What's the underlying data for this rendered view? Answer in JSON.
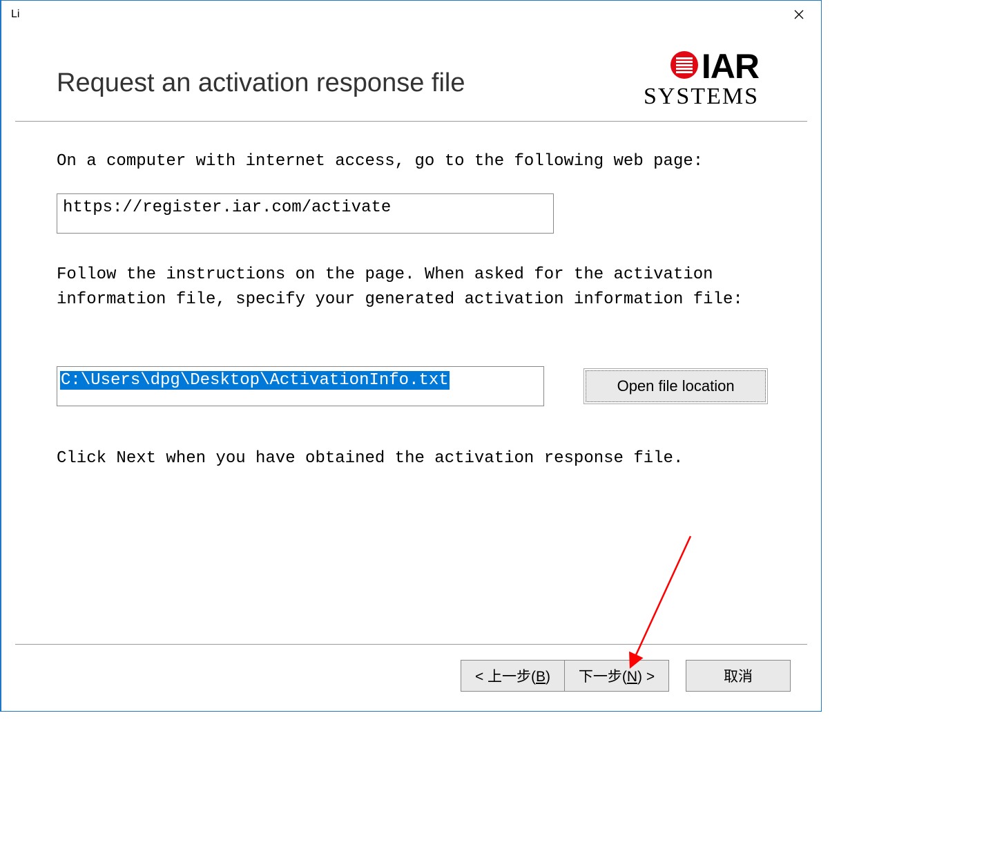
{
  "window": {
    "title": "Li"
  },
  "header": {
    "page_title": "Request an activation response file",
    "logo_top": "IAR",
    "logo_bottom": "SYSTEMS"
  },
  "body": {
    "instruction_1": "On a computer with internet access, go to the following web page:",
    "url_value": "https://register.iar.com/activate",
    "instruction_2": "Follow the instructions on the page. When asked for the activation information file, specify your generated activation information file:",
    "file_path_value": "C:\\Users\\dpg\\Desktop\\ActivationInfo.txt",
    "open_location_label": "Open file location",
    "instruction_3": "Click Next when you have obtained the activation response file."
  },
  "footer": {
    "back_prefix": "< 上一步(",
    "back_key": "B",
    "back_suffix": ")",
    "next_prefix": "下一步(",
    "next_key": "N",
    "next_suffix": ") >",
    "cancel_label": "取消"
  }
}
